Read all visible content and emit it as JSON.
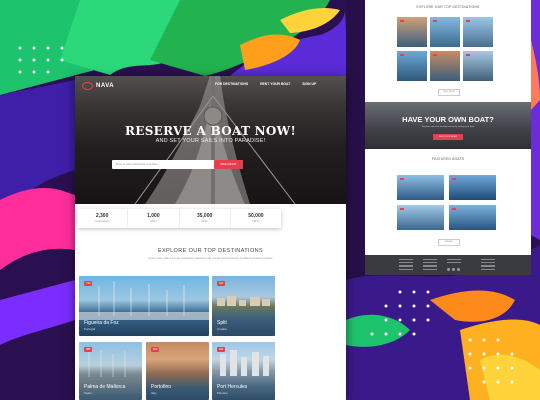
{
  "colors": {
    "accent": "#e6404f",
    "background": "#2a1050"
  },
  "main": {
    "logo": "NAVA",
    "nav": [
      "FOR DESTINATIONS",
      "RENT YOUR BOAT",
      "SIGN UP"
    ],
    "hero_title": "RESERVE A BOAT NOW!",
    "hero_sub": "AND SET YOUR SAILS INTO PARADISE!",
    "search_placeholder": "Enter to select destination and dates",
    "search_button": "FIND A BOAT",
    "stats": [
      {
        "value": "2,300",
        "label": "Destinations"
      },
      {
        "value": "1,000",
        "label": "Cities"
      },
      {
        "value": "35,000",
        "label": "Boats"
      },
      {
        "value": "50,000",
        "label": "Sailors"
      }
    ],
    "dest_title": "EXPLORE OUR TOP DESTINATIONS",
    "dest_sub": "Lorem ipsum dolor sit amet, consectetur adipiscing elit, sed do eiusmod tempor incididunt ut labore et dolore",
    "cards": [
      {
        "badge": "740",
        "name": "Figueira da Foz",
        "loc": "Portugal"
      },
      {
        "badge": "321",
        "name": "Split",
        "loc": "Croatia"
      },
      {
        "badge": "985",
        "name": "Palma de Mallorca",
        "loc": "Spain"
      },
      {
        "badge": "640",
        "name": "Portofino",
        "loc": "Italy"
      },
      {
        "badge": "461",
        "name": "Port Hercules",
        "loc": "Monaco"
      }
    ]
  },
  "side": {
    "dest_title": "EXPLORE OUR TOP DESTINATIONS",
    "more_btn": "VIEW MORE",
    "own_title": "HAVE YOUR OWN BOAT?",
    "own_sub": "Register and start earning money by renting your boat",
    "own_btn": "ADD YOUR BOAT",
    "featured_title": "FEATURED BOATS",
    "more_btn2": "VIEW ALL"
  }
}
